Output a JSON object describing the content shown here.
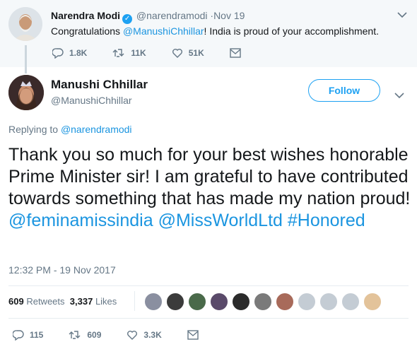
{
  "parent_tweet": {
    "name": "Narendra Modi",
    "handle": "@narendramodi",
    "time": "·Nov 19",
    "text_before": "Congratulations ",
    "mention": "@ManushiChhillar",
    "text_after": "! India is proud of your accomplishment.",
    "replies": "1.8K",
    "retweets": "11K",
    "likes": "51K"
  },
  "tweet": {
    "name": "Manushi Chhillar",
    "handle": "@ManushiChhillar",
    "follow_label": "Follow",
    "replying_label": "Replying to ",
    "replying_to": "@narendramodi",
    "text": "Thank you so much for your best wishes honorable Prime Minister sir! I am grateful to have contributed towards something that has made my nation proud! ",
    "mention1": "@feminamissindia",
    "mention2": "@MissWorldLtd",
    "hashtag": "#Honored",
    "timestamp": "12:32 PM - 19 Nov 2017",
    "retweet_count": "609",
    "retweet_label": "Retweets",
    "like_count": "3,337",
    "like_label": "Likes",
    "replies": "115",
    "retweets": "609",
    "likes": "3.3K"
  },
  "colors": {
    "accent": "#1da1f2",
    "link": "#1b95e0",
    "muted": "#657786"
  }
}
